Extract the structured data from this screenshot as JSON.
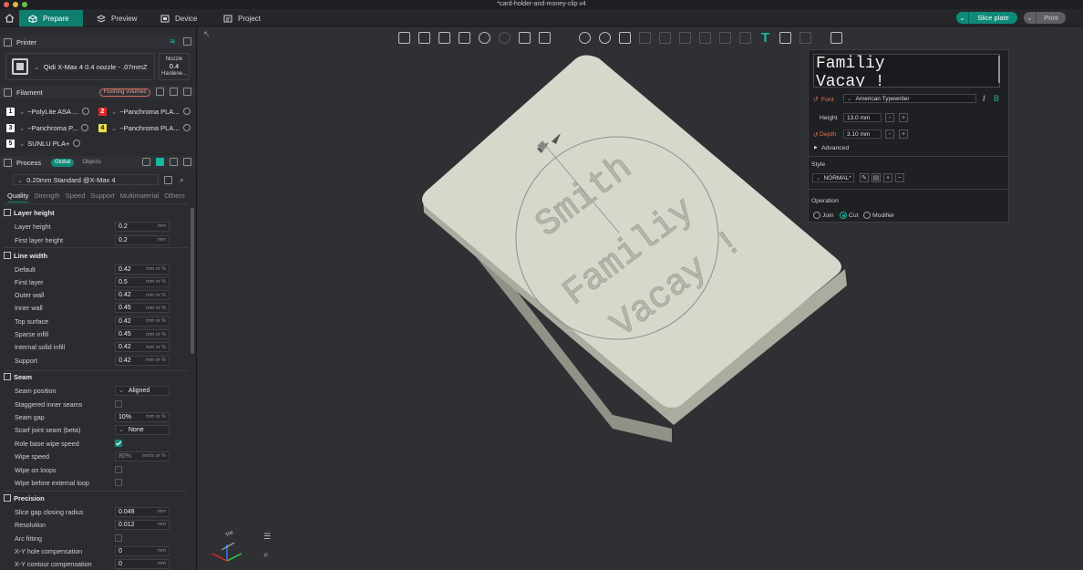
{
  "window": {
    "title": "*card-holder-and-money-clip v4"
  },
  "nav": {
    "tabs": [
      {
        "label": "Prepare"
      },
      {
        "label": "Preview"
      },
      {
        "label": "Device"
      },
      {
        "label": "Project"
      }
    ],
    "slice_label": "Slice plate",
    "print_label": "Print"
  },
  "printer": {
    "section_title": "Printer",
    "name": "Qidi X-Max 4 0.4 nozzle - .07mmZ",
    "nozzle_label": "Nozzle",
    "nozzle_value": "0.4",
    "hardened_label": "Hardene..."
  },
  "filament": {
    "section_title": "Filament",
    "flushing_label": "Flushing volumes",
    "items": [
      {
        "num": "1",
        "name": "~PolyLite ASA ...",
        "color": "#ffffff",
        "text": "#111111"
      },
      {
        "num": "2",
        "name": "~Panchroma PLA...",
        "color": "#e0262b",
        "text": "#ffffff"
      },
      {
        "num": "3",
        "name": "~Panchroma P...",
        "color": "#ffffff",
        "text": "#111111"
      },
      {
        "num": "4",
        "name": "~Panchroma PLA...",
        "color": "#e8e04a",
        "text": "#111111"
      },
      {
        "num": "5",
        "name": "SUNLU PLA+",
        "color": "#ffffff",
        "text": "#111111"
      }
    ]
  },
  "process": {
    "section_title": "Process",
    "global_label": "Global",
    "objects_label": "Objects",
    "preset": "0.20mm Standard @X-Max 4",
    "tabs": [
      "Quality",
      "Strength",
      "Speed",
      "Support",
      "Multimaterial",
      "Others"
    ]
  },
  "settings": {
    "layer_height": {
      "title": "Layer height",
      "rows": [
        {
          "label": "Layer height",
          "value": "0.2",
          "unit": "mm"
        },
        {
          "label": "First layer height",
          "value": "0.2",
          "unit": "mm"
        }
      ]
    },
    "line_width": {
      "title": "Line width",
      "rows": [
        {
          "label": "Default",
          "value": "0.42",
          "unit": "mm or %"
        },
        {
          "label": "First layer",
          "value": "0.5",
          "unit": "mm or %"
        },
        {
          "label": "Outer wall",
          "value": "0.42",
          "unit": "mm or %"
        },
        {
          "label": "Inner wall",
          "value": "0.45",
          "unit": "mm or %"
        },
        {
          "label": "Top surface",
          "value": "0.42",
          "unit": "mm or %"
        },
        {
          "label": "Sparse infill",
          "value": "0.45",
          "unit": "mm or %"
        },
        {
          "label": "Internal solid infill",
          "value": "0.42",
          "unit": "mm or %"
        },
        {
          "label": "Support",
          "value": "0.42",
          "unit": "mm or %"
        }
      ]
    },
    "seam": {
      "title": "Seam",
      "seam_position_label": "Seam position",
      "seam_position_value": "Aligned",
      "staggered_label": "Staggered inner seams",
      "seam_gap_label": "Seam gap",
      "seam_gap_value": "10%",
      "seam_gap_unit": "mm or %",
      "scarf_label": "Scarf joint seam (beta)",
      "scarf_value": "None",
      "role_wipe_label": "Role base wipe speed",
      "wipe_speed_label": "Wipe speed",
      "wipe_speed_value": "80%",
      "wipe_speed_unit": "mm/s or %",
      "wipe_loops_label": "Wipe on loops",
      "wipe_before_label": "Wipe before external loop"
    },
    "precision": {
      "title": "Precision",
      "rows": [
        {
          "label": "Slice gap closing radius",
          "value": "0.049",
          "unit": "mm"
        },
        {
          "label": "Resolution",
          "value": "0.012",
          "unit": "mm"
        }
      ],
      "arc_label": "Arc fitting",
      "rows2": [
        {
          "label": "X-Y hole compensation",
          "value": "0",
          "unit": "mm"
        },
        {
          "label": "X-Y contour compensation",
          "value": "0",
          "unit": "mm"
        }
      ]
    }
  },
  "text_tool": {
    "preview_line1": "Familiy",
    "preview_line2": "Vacay !",
    "font_label": "Font",
    "font_value": "American Typewriter",
    "italic_label": "I",
    "bold_label": "B",
    "height_label": "Height",
    "height_value": "13.0 mm",
    "depth_label": "Depth",
    "depth_value": "3.10 mm",
    "minus": "-",
    "plus": "+",
    "advanced_label": "Advanced",
    "style_title": "Style",
    "style_value": "NORMAL*",
    "operation_title": "Operation",
    "op_join": "Join",
    "op_cut": "Cut",
    "op_modifier": "Modifier"
  },
  "model_text": {
    "line1": "Smith",
    "line2": "Familiy",
    "line3": "Vacay !"
  },
  "axes": {
    "top_label": "Top"
  },
  "colors": {
    "accent": "#0e8a78",
    "model": "#d4d9cc",
    "model_side": "#a9ad9f"
  }
}
